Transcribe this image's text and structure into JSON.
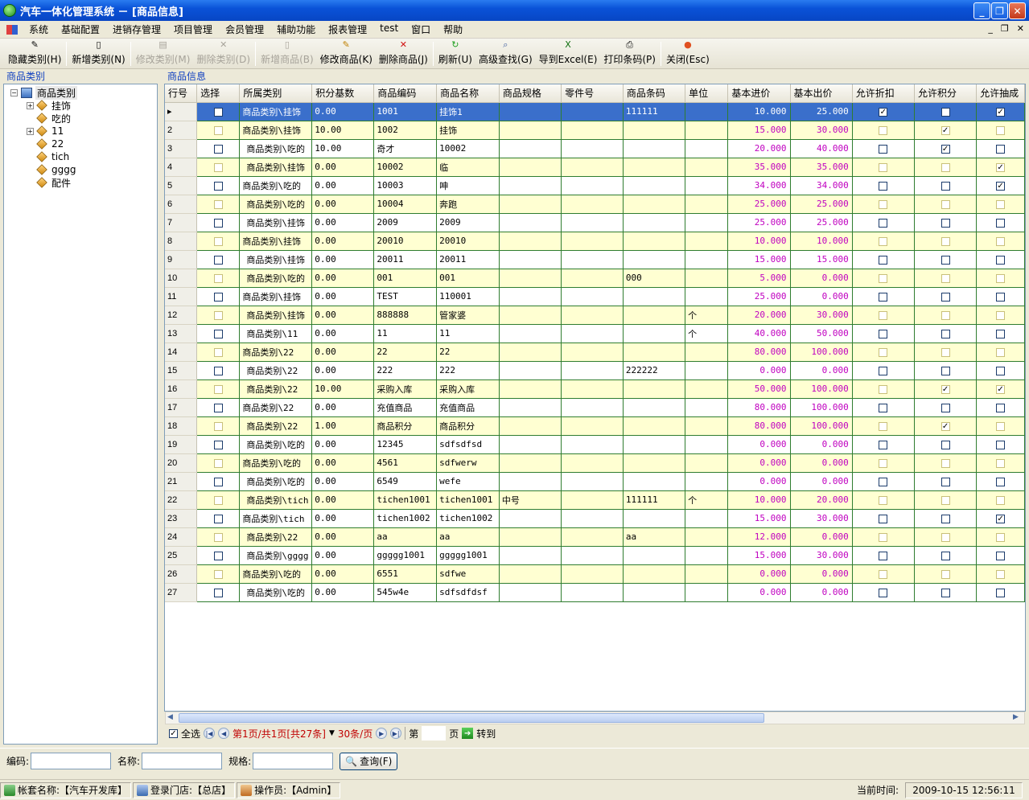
{
  "window": {
    "title": "汽车一体化管理系统 － [商品信息]"
  },
  "menu": [
    "系统",
    "基础配置",
    "进销存管理",
    "项目管理",
    "会员管理",
    "辅助功能",
    "报表管理",
    "test",
    "窗口",
    "帮助"
  ],
  "toolbar": [
    {
      "label": "隐藏类别(H)",
      "icon": "hide-category-icon",
      "enabled": true
    },
    {
      "label": "新增类别(N)",
      "icon": "new-category-icon",
      "enabled": true
    },
    {
      "label": "修改类别(M)",
      "icon": "edit-category-icon",
      "enabled": false
    },
    {
      "label": "删除类别(D)",
      "icon": "delete-category-icon",
      "enabled": false
    },
    {
      "label": "新增商品(B)",
      "icon": "new-product-icon",
      "enabled": false
    },
    {
      "label": "修改商品(K)",
      "icon": "edit-product-icon",
      "enabled": true
    },
    {
      "label": "删除商品(J)",
      "icon": "delete-product-icon",
      "enabled": true
    },
    {
      "label": "刷新(U)",
      "icon": "refresh-icon",
      "enabled": true
    },
    {
      "label": "高级查找(G)",
      "icon": "advanced-search-icon",
      "enabled": true
    },
    {
      "label": "导到Excel(E)",
      "icon": "excel-icon",
      "enabled": true
    },
    {
      "label": "打印条码(P)",
      "icon": "print-icon",
      "enabled": true
    },
    {
      "label": "关闭(Esc)",
      "icon": "close-icon",
      "enabled": true
    }
  ],
  "left": {
    "header": "商品类别",
    "root": "商品类别",
    "nodes": [
      "挂饰",
      "吃的",
      "11",
      "22",
      "tich",
      "gggg",
      "配件"
    ]
  },
  "grid": {
    "header": "商品信息",
    "columns": [
      "行号",
      "选择",
      "所属类别",
      "积分基数",
      "商品编码",
      "商品名称",
      "商品规格",
      "零件号",
      "商品条码",
      "单位",
      "基本进价",
      "基本出价",
      "允许折扣",
      "允许积分",
      "允许抽成"
    ],
    "rows": [
      [
        "1",
        false,
        "商品类别\\挂饰",
        "0.00",
        "1001",
        "挂饰1",
        "",
        "",
        "111111",
        "",
        "10.000",
        "25.000",
        true,
        false,
        true
      ],
      [
        "2",
        false,
        "商品类别\\挂饰",
        "10.00",
        "1002",
        "挂饰",
        "",
        "",
        "",
        "",
        "15.000",
        "30.000",
        false,
        true,
        false
      ],
      [
        "3",
        false,
        "商品类别\\吃的",
        "10.00",
        "奇才",
        "10002",
        "",
        "",
        "",
        "",
        "20.000",
        "40.000",
        false,
        true,
        false
      ],
      [
        "4",
        false,
        "商品类别\\挂饰",
        "0.00",
        "10002",
        "临",
        "",
        "",
        "",
        "",
        "35.000",
        "35.000",
        false,
        false,
        true
      ],
      [
        "5",
        false,
        "商品类别\\吃的",
        "0.00",
        "10003",
        "呻",
        "",
        "",
        "",
        "",
        "34.000",
        "34.000",
        false,
        false,
        true
      ],
      [
        "6",
        false,
        "商品类别\\吃的",
        "0.00",
        "10004",
        "奔跑",
        "",
        "",
        "",
        "",
        "25.000",
        "25.000",
        false,
        false,
        false
      ],
      [
        "7",
        false,
        "商品类别\\挂饰",
        "0.00",
        "2009",
        "2009",
        "",
        "",
        "",
        "",
        "25.000",
        "25.000",
        false,
        false,
        false
      ],
      [
        "8",
        false,
        "商品类别\\挂饰",
        "0.00",
        "20010",
        "20010",
        "",
        "",
        "",
        "",
        "10.000",
        "10.000",
        false,
        false,
        false
      ],
      [
        "9",
        false,
        "商品类别\\挂饰",
        "0.00",
        "20011",
        "20011",
        "",
        "",
        "",
        "",
        "15.000",
        "15.000",
        false,
        false,
        false
      ],
      [
        "10",
        false,
        "商品类别\\吃的",
        "0.00",
        "001",
        "001",
        "",
        "",
        "000",
        "",
        "5.000",
        "0.000",
        false,
        false,
        false
      ],
      [
        "11",
        false,
        "商品类别\\挂饰",
        "0.00",
        "TEST",
        "110001",
        "",
        "",
        "",
        "",
        "25.000",
        "0.000",
        false,
        false,
        false
      ],
      [
        "12",
        false,
        "商品类别\\挂饰",
        "0.00",
        "888888",
        "管家婆",
        "",
        "",
        "",
        "个",
        "20.000",
        "30.000",
        false,
        false,
        false
      ],
      [
        "13",
        false,
        "商品类别\\11",
        "0.00",
        "11",
        "11",
        "",
        "",
        "",
        "个",
        "40.000",
        "50.000",
        false,
        false,
        false
      ],
      [
        "14",
        false,
        "商品类别\\22",
        "0.00",
        "22",
        "22",
        "",
        "",
        "",
        "",
        "80.000",
        "100.000",
        false,
        false,
        false
      ],
      [
        "15",
        false,
        "商品类别\\22",
        "0.00",
        "222",
        "222",
        "",
        "",
        "222222",
        "",
        "0.000",
        "0.000",
        false,
        false,
        false
      ],
      [
        "16",
        false,
        "商品类别\\22",
        "10.00",
        "采购入库",
        "采购入库",
        "",
        "",
        "",
        "",
        "50.000",
        "100.000",
        false,
        true,
        true
      ],
      [
        "17",
        false,
        "商品类别\\22",
        "0.00",
        "充值商品",
        "充值商品",
        "",
        "",
        "",
        "",
        "80.000",
        "100.000",
        false,
        false,
        false
      ],
      [
        "18",
        false,
        "商品类别\\22",
        "1.00",
        "商品积分",
        "商品积分",
        "",
        "",
        "",
        "",
        "80.000",
        "100.000",
        false,
        true,
        false
      ],
      [
        "19",
        false,
        "商品类别\\吃的",
        "0.00",
        "12345",
        "sdfsdfsd",
        "",
        "",
        "",
        "",
        "0.000",
        "0.000",
        false,
        false,
        false
      ],
      [
        "20",
        false,
        "商品类别\\吃的",
        "0.00",
        "4561",
        "sdfwerw",
        "",
        "",
        "",
        "",
        "0.000",
        "0.000",
        false,
        false,
        false
      ],
      [
        "21",
        false,
        "商品类别\\吃的",
        "0.00",
        "6549",
        "wefe",
        "",
        "",
        "",
        "",
        "0.000",
        "0.000",
        false,
        false,
        false
      ],
      [
        "22",
        false,
        "商品类别\\tich",
        "0.00",
        "tichen1001",
        "tichen1001",
        "中号",
        "",
        "111111",
        "个",
        "10.000",
        "20.000",
        false,
        false,
        false
      ],
      [
        "23",
        false,
        "商品类别\\tich",
        "0.00",
        "tichen1002",
        "tichen1002",
        "",
        "",
        "",
        "",
        "15.000",
        "30.000",
        false,
        false,
        true
      ],
      [
        "24",
        false,
        "商品类别\\22",
        "0.00",
        "aa",
        "aa",
        "",
        "",
        "aa",
        "",
        "12.000",
        "0.000",
        false,
        false,
        false
      ],
      [
        "25",
        false,
        "商品类别\\gggg",
        "0.00",
        "ggggg1001",
        "ggggg1001",
        "",
        "",
        "",
        "",
        "15.000",
        "30.000",
        false,
        false,
        false
      ],
      [
        "26",
        false,
        "商品类别\\吃的",
        "0.00",
        "6551",
        "sdfwe",
        "",
        "",
        "",
        "",
        "0.000",
        "0.000",
        false,
        false,
        false
      ],
      [
        "27",
        false,
        "商品类别\\吃的",
        "0.00",
        "545w4e",
        "sdfsdfdsf",
        "",
        "",
        "",
        "",
        "0.000",
        "0.000",
        false,
        false,
        false
      ]
    ]
  },
  "pager": {
    "select_all": "全选",
    "info": "第1页/共1页[共27条]",
    "per_page": "30条/页",
    "page_prefix": "第",
    "page_suffix": "页",
    "goto": "转到"
  },
  "search": {
    "code_label": "编码:",
    "name_label": "名称:",
    "spec_label": "规格:",
    "button": "查询(F)"
  },
  "status": {
    "account": "帐套名称:【汽车开发库】",
    "store": "登录门店:【总店】",
    "operator": "操作员:【Admin】",
    "time_label": "当前时间:",
    "time": "2009-10-15 12:56:11"
  }
}
